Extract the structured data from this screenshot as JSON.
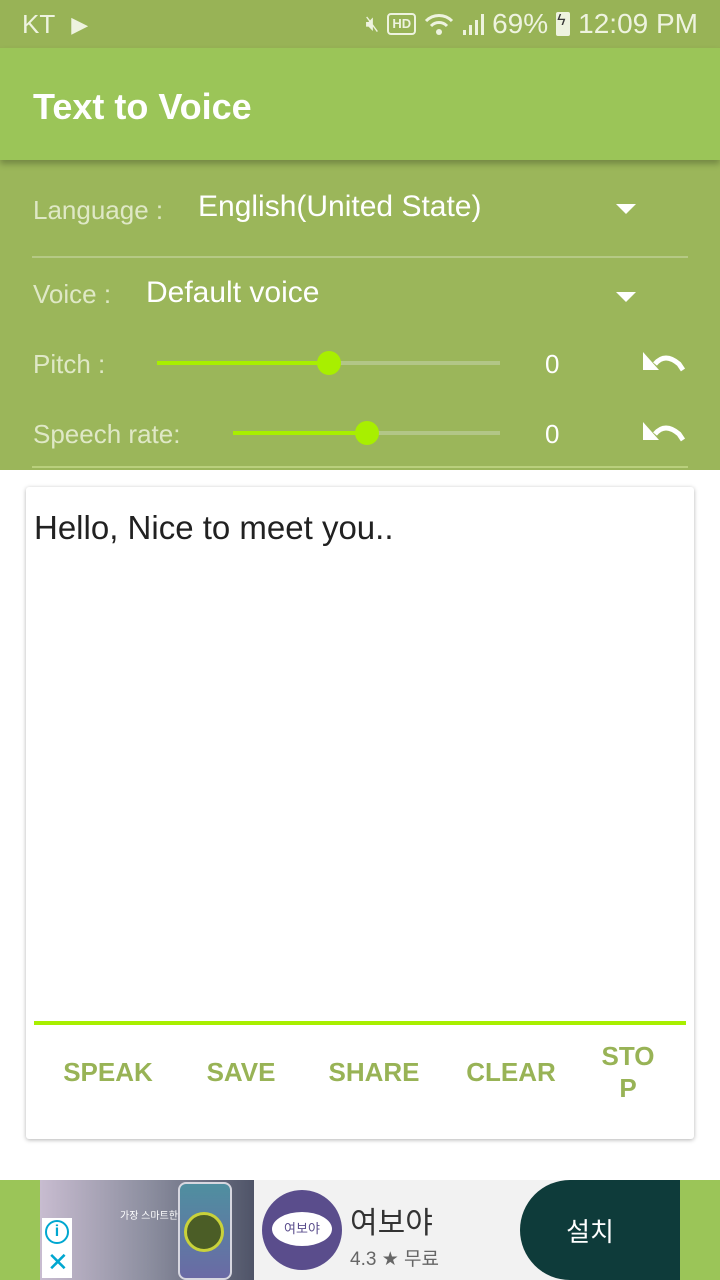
{
  "status_bar": {
    "carrier": "KT",
    "battery": "69%",
    "time": "12:09 PM",
    "icons": [
      "play-store-icon",
      "mute-icon",
      "hd-icon",
      "wifi-icon",
      "signal-icon",
      "battery-icon"
    ],
    "hd_label": "HD"
  },
  "app_bar": {
    "title": "Text to Voice"
  },
  "settings": {
    "language_label": "Language :",
    "language_value": "English(United State)",
    "voice_label": "Voice :",
    "voice_value": "Default voice",
    "pitch_label": "Pitch :",
    "pitch_value": "0",
    "pitch_position": 0.5,
    "rate_label": "Speech rate:",
    "rate_value": "0",
    "rate_position": 0.5
  },
  "editor": {
    "text": "Hello, Nice to meet you.."
  },
  "actions": {
    "speak": "SPEAK",
    "save": "SAVE",
    "share": "SHARE",
    "clear": "CLEAR",
    "stop": "STOP"
  },
  "ad": {
    "image_text": "가장 스마트한 결혼중개앱",
    "app_icon_text": "여보야",
    "app_name": "여보야",
    "rating": "4.3 ★ 무료",
    "install_label": "설치",
    "info_glyph": "i",
    "close_glyph": "✕"
  },
  "colors": {
    "primary": "#9bc558",
    "settings_bg": "#9bb65a",
    "accent": "#a8ef00",
    "button_text": "#98b356"
  }
}
